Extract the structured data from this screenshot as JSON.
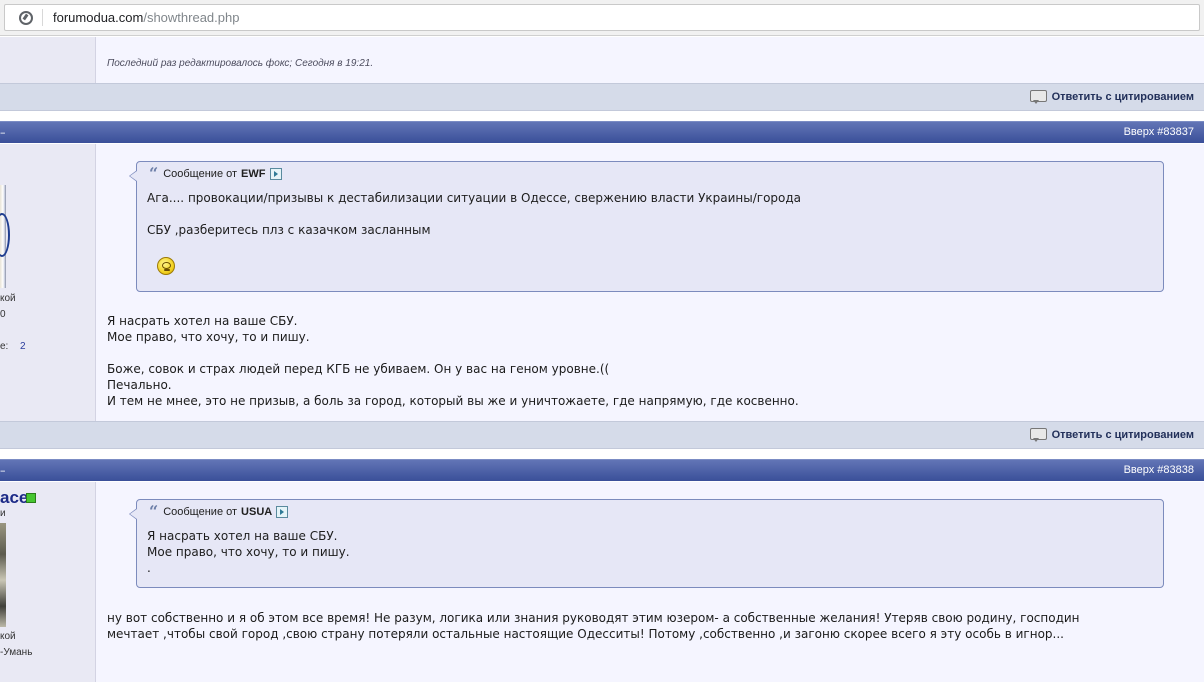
{
  "browser": {
    "url_domain": "forumodua.com",
    "url_path": "/showthread.php"
  },
  "post_previous": {
    "edit_note": "Последний раз редактировалось фокс; Сегодня в 19:21.",
    "reply_with_quote": "Ответить с цитированием"
  },
  "post_83837": {
    "header_right": "Вверх #83837",
    "header_left": "",
    "quote": {
      "label": "Сообщение от",
      "author": "EWF",
      "lines": [
        "Ага.... провокации/призывы к дестабилизации ситуации в Одессе, свержению власти Украины/города",
        "СБУ ,разберитесь плз с казачком засланным"
      ]
    },
    "message_lines": [
      "Я насрать хотел на ваше СБУ.",
      "Мое право, что хочу, то и пишу.",
      "",
      "Боже, совок и страх людей перед КГБ не убиваем. Он у вас на геном уровне.((",
      "Печально.",
      "И тем не мнее, это не призыв, а боль за город, который вы же и уничтожаете, где напрямую, где косвенно."
    ],
    "left_info": {
      "line1": "кой",
      "line2": "0",
      "line3_label": "е:",
      "line3_value": "2"
    },
    "reply_with_quote": "Ответить с цитированием"
  },
  "post_83838": {
    "header_right": "Вверх #83838",
    "username": "ace",
    "quote": {
      "label": "Сообщение от",
      "author": "USUA",
      "lines": [
        "Я насрать хотел на ваше СБУ.",
        "Мое право, что хочу, то и пишу.",
        "."
      ]
    },
    "message_lines": [
      "ну вот собственно и я об этом все время! Не разум, логика или знания руководят этим юзером- а собственные желания! Утеряв свою родину, господин",
      "мечтает ,чтобы свой город ,свою страну потеряли остальные настоящие Одесситы! Потому ,собственно ,и загоню скорее всего я эту особь в игнор..."
    ],
    "left_info": {
      "line0": "и",
      "line1": "кой",
      "line2": "-Умань"
    }
  }
}
